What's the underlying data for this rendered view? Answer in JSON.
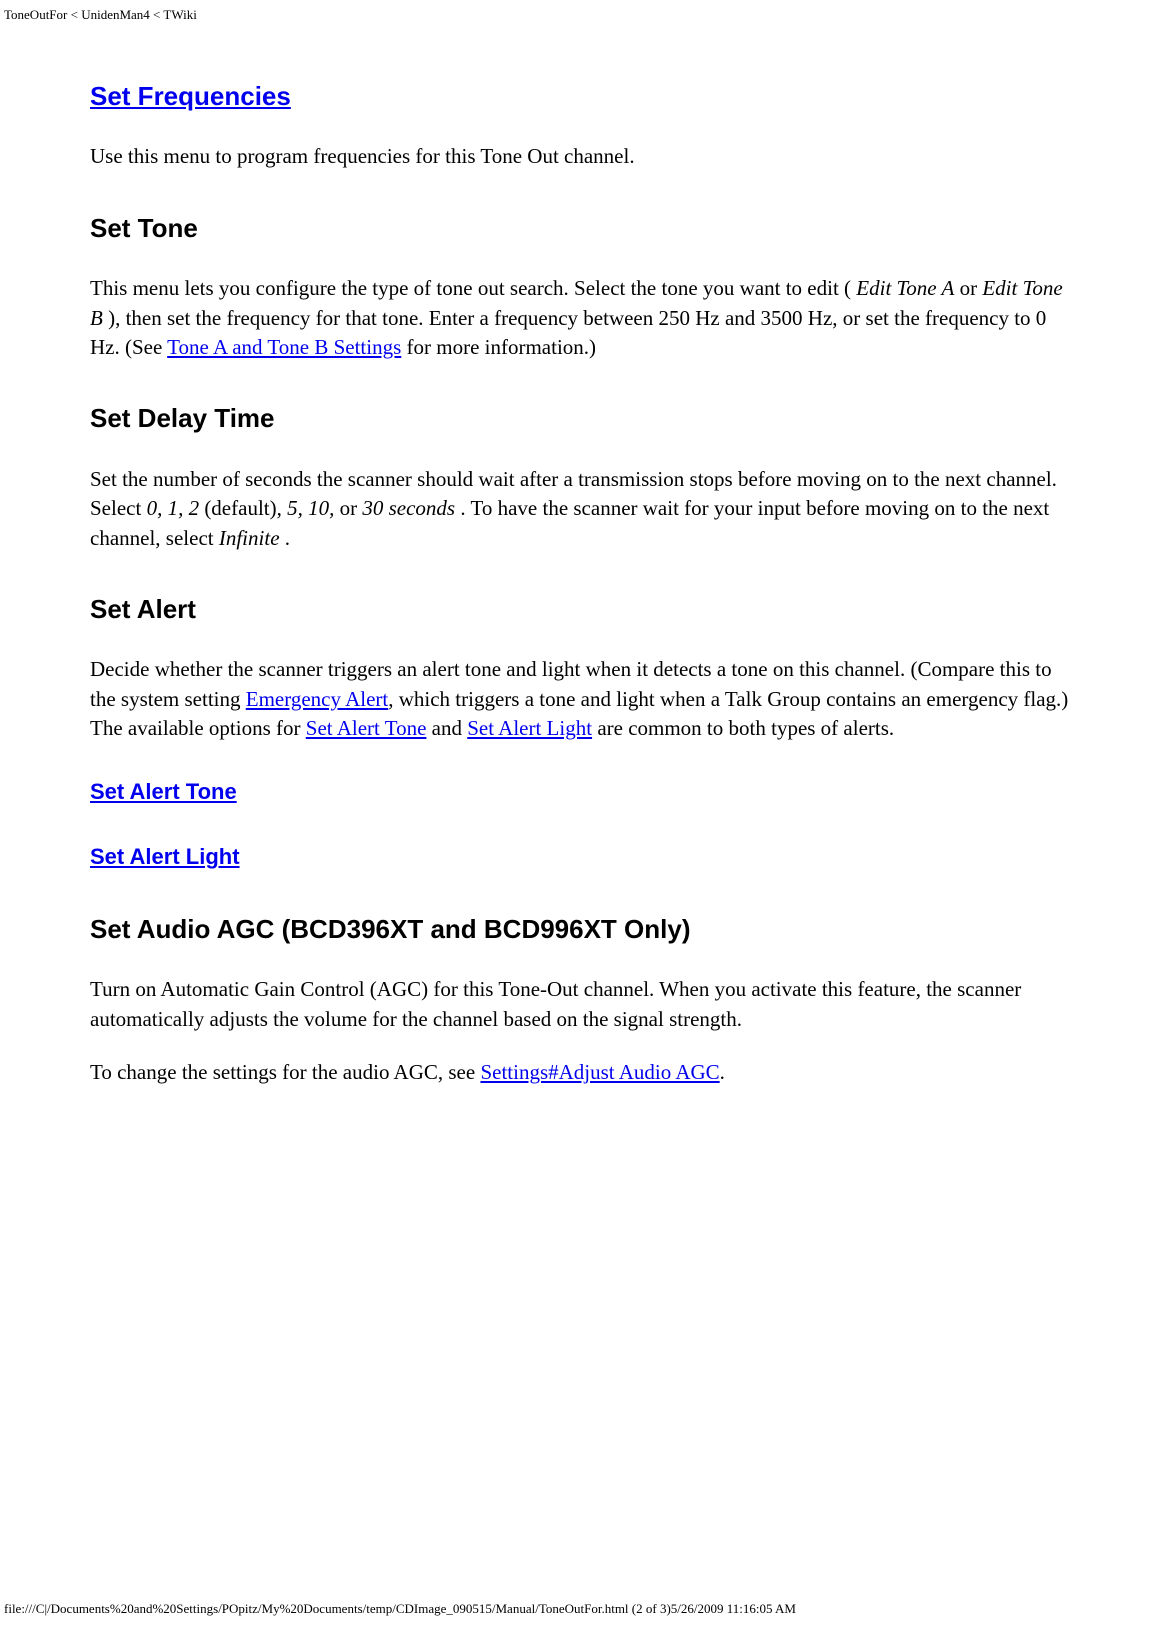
{
  "header": {
    "breadcrumb": "ToneOutFor < UnidenMan4 < TWiki"
  },
  "sections": {
    "set_frequencies": {
      "title": "Set Frequencies",
      "body": "Use this menu to program frequencies for this Tone Out channel."
    },
    "set_tone": {
      "title": "Set Tone",
      "body_pre": "This menu lets you configure the type of tone out search. Select the tone you want to edit ( ",
      "em_a": "Edit Tone A",
      "mid1": " or ",
      "em_b": "Edit Tone B",
      "mid2": " ), then set the frequency for that tone. Enter a frequency between 250 Hz and 3500 Hz, or set the frequency to 0 Hz. (See ",
      "link": "Tone A and Tone B Settings",
      "post": " for more information.)"
    },
    "set_delay": {
      "title": "Set Delay Time",
      "pre": "Set the number of seconds the scanner should wait after a transmission stops before moving on to the next channel. Select ",
      "em1": "0, 1, 2",
      "mid1": " (default), ",
      "em2": "5, 10,",
      "mid2": " or ",
      "em3": "30 seconds",
      "mid3": " . To have the scanner wait for your input before moving on to the next channel, select ",
      "em4": "Infinite",
      "post": " ."
    },
    "set_alert": {
      "title": "Set Alert",
      "pre": "Decide whether the scanner triggers an alert tone and light when it detects a tone on this channel. (Compare this to the system setting ",
      "link1": "Emergency Alert",
      "mid1": ", which triggers a tone and light when a Talk Group contains an emergency flag.) The available options for ",
      "link2": "Set Alert Tone",
      "mid2": " and ",
      "link3": "Set Alert Light",
      "post": " are common to both types of alerts.",
      "sub_tone": "Set Alert Tone",
      "sub_light": "Set Alert Light"
    },
    "set_agc": {
      "title": "Set Audio AGC (BCD396XT and BCD996XT Only)",
      "body1": "Turn on Automatic Gain Control (AGC) for this Tone-Out channel. When you activate this feature, the scanner automatically adjusts the volume for the channel based on the signal strength.",
      "body2_pre": "To change the settings for the audio AGC, see ",
      "body2_link": "Settings#Adjust Audio AGC",
      "body2_post": "."
    }
  },
  "footer": {
    "path": "file:///C|/Documents%20and%20Settings/POpitz/My%20Documents/temp/CDImage_090515/Manual/ToneOutFor.html (2 of 3)5/26/2009 11:16:05 AM"
  }
}
